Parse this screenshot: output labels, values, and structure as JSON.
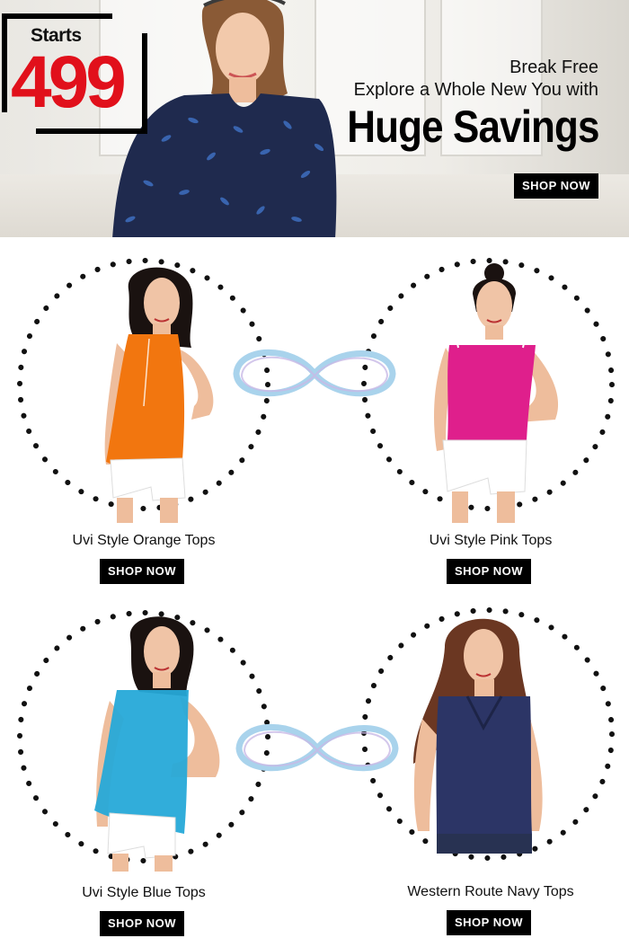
{
  "hero": {
    "badge_starts": "Starts",
    "badge_price": "499",
    "line1": "Break Free",
    "line2": "Explore a Whole New You with",
    "title": "Huge Savings",
    "cta": "SHOP NOW"
  },
  "products": [
    {
      "name": "Uvi Style Orange Tops",
      "cta": "SHOP NOW",
      "color": "#f2760f"
    },
    {
      "name": "Uvi Style Pink Tops",
      "cta": "SHOP NOW",
      "color": "#df1f8c"
    },
    {
      "name": "Uvi Style Blue Tops",
      "cta": "SHOP NOW",
      "color": "#26a9d8"
    },
    {
      "name": "Western Route Navy Tops",
      "cta": "SHOP NOW",
      "color": "#2c3566"
    }
  ],
  "colors": {
    "price_red": "#e1101b",
    "button_bg": "#000000",
    "infinity_blue": "#a9d3ec"
  }
}
